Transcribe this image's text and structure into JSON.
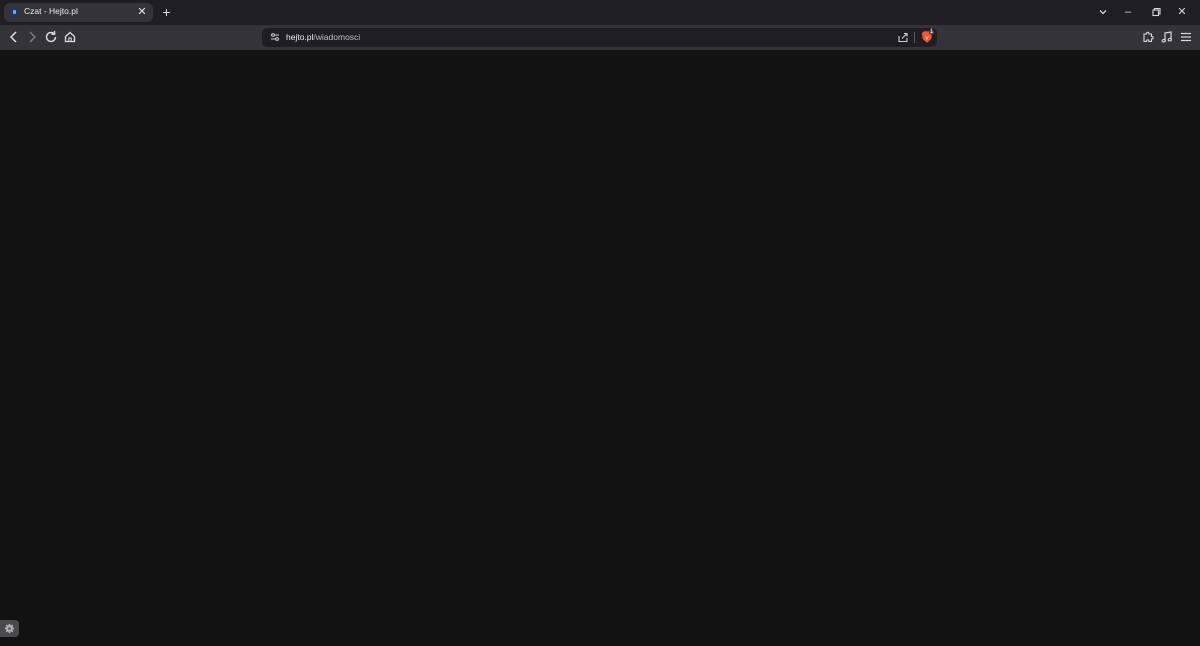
{
  "tab": {
    "title": "Czat - Hejto.pl",
    "close_glyph": "✕"
  },
  "new_tab_glyph": "+",
  "window_controls": {
    "tab_search_glyph": "⌄",
    "minimize_glyph": "–",
    "restore_glyph": "❐",
    "close_glyph": "✕"
  },
  "toolbar": {
    "back_icon": "chevron-left",
    "forward_icon": "chevron-right",
    "reload_icon": "reload",
    "home_icon": "home"
  },
  "omnibox": {
    "host": "hejto.pl",
    "path": "/wiadomosci"
  },
  "brave_shields_badge": "1",
  "extensions": [
    "puzzle",
    "music",
    "menu"
  ],
  "colors": {
    "background": "#121212",
    "tabstrip": "#1f1e23",
    "toolbar": "#343338",
    "brave_orange": "#fb542b"
  }
}
